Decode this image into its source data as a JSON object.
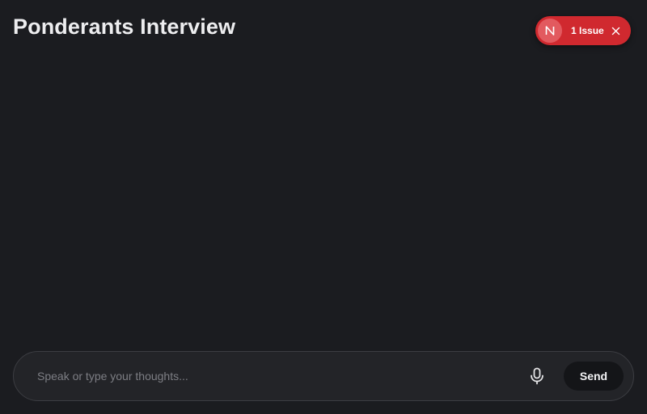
{
  "header": {
    "title": "Ponderants Interview"
  },
  "issue_badge": {
    "logo_letter": "N",
    "label": "1 Issue",
    "background_color": "#d0292f",
    "logo_icon": "nextjs-logo-icon",
    "close_icon": "close-icon"
  },
  "composer": {
    "placeholder": "Speak or type your thoughts...",
    "value": "",
    "mic_icon": "microphone-icon",
    "send_label": "Send"
  }
}
